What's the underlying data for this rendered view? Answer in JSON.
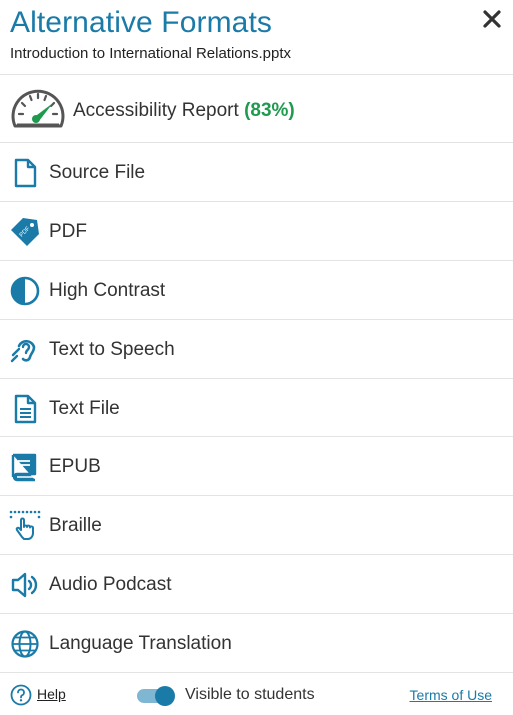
{
  "header": {
    "title": "Alternative Formats",
    "filename": "Introduction to International Relations.pptx"
  },
  "report": {
    "label": "Accessibility Report",
    "score": "(83%)",
    "score_value": 83,
    "score_color": "#1f9a4f"
  },
  "formats": [
    {
      "label": "Source File",
      "icon": "file-icon"
    },
    {
      "label": "PDF",
      "icon": "pdf-tag-icon"
    },
    {
      "label": "High Contrast",
      "icon": "contrast-icon"
    },
    {
      "label": "Text to Speech",
      "icon": "hearing-icon"
    },
    {
      "label": "Text File",
      "icon": "text-file-icon"
    },
    {
      "label": "EPUB",
      "icon": "book-icon"
    },
    {
      "label": "Braille",
      "icon": "braille-hand-icon"
    },
    {
      "label": "Audio Podcast",
      "icon": "speaker-icon"
    },
    {
      "label": "Language Translation",
      "icon": "globe-icon"
    }
  ],
  "footer": {
    "help": "Help",
    "visible_label": "Visible to students",
    "visible_on": true,
    "terms": "Terms of Use"
  },
  "colors": {
    "accent": "#1a7aa8",
    "text": "#333333",
    "divider": "#e3e3e3"
  }
}
